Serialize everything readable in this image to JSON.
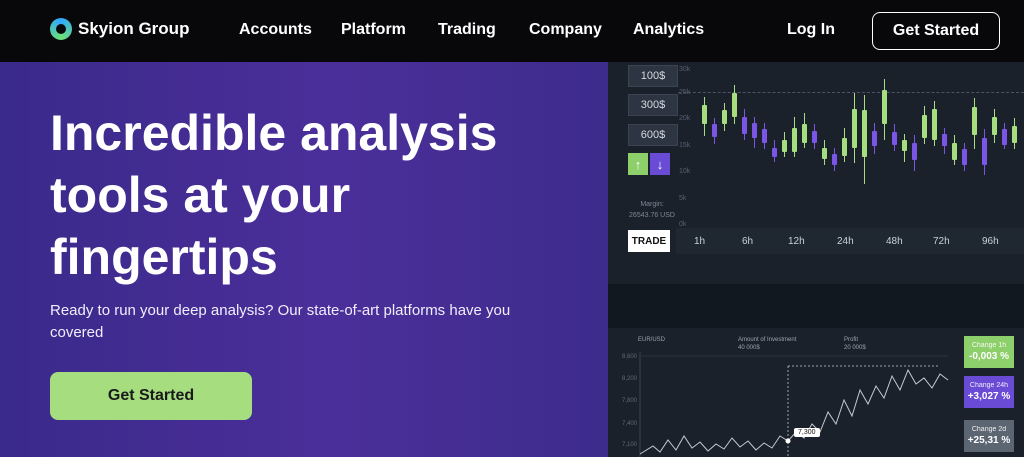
{
  "nav": {
    "brand": "Skyion Group",
    "links": [
      "Accounts",
      "Platform",
      "Trading",
      "Company",
      "Analytics"
    ],
    "login": "Log In",
    "cta": "Get Started"
  },
  "hero": {
    "title": "Incredible analysis tools at your fingertips",
    "subtitle": "Ready to run your deep analysis? Our state-of-art platforms have you covered",
    "cta": "Get Started"
  },
  "trading": {
    "amounts": [
      "100$",
      "300$",
      "600$"
    ],
    "up_arrow": "↑",
    "down_arrow": "↓",
    "margin_label": "Margin:",
    "margin_value": "26543.76 USD",
    "trade": "TRADE",
    "timeframes": [
      "1h",
      "6h",
      "12h",
      "24h",
      "48h",
      "72h",
      "96h"
    ],
    "y_ticks": [
      "30k",
      "25k",
      "20k",
      "15k",
      "10k",
      "5k",
      "0k"
    ],
    "bottom": {
      "pair": "EUR/USD",
      "investment_label": "Amount of Investment",
      "investment_value": "40 000$",
      "profit_label": "Profit",
      "profit_value": "20 000$",
      "y_ticks": [
        "8,600",
        "8,200",
        "7,800",
        "7,400",
        "7,100"
      ],
      "tooltip": "7,300",
      "changes": [
        {
          "label": "Change 1h",
          "value": "-0,003 %",
          "color": "#8dcf6a"
        },
        {
          "label": "Change 24h",
          "value": "+3,027 %",
          "color": "#6a4bd6"
        },
        {
          "label": "Change 2d",
          "value": "+25,31 %",
          "color": "#5c6672"
        }
      ]
    }
  },
  "colors": {
    "accent_green": "#a5dd7f",
    "hero_purple": "#4b2e9a",
    "candle_up": "#a5dd7f",
    "candle_down": "#7b55e6"
  }
}
